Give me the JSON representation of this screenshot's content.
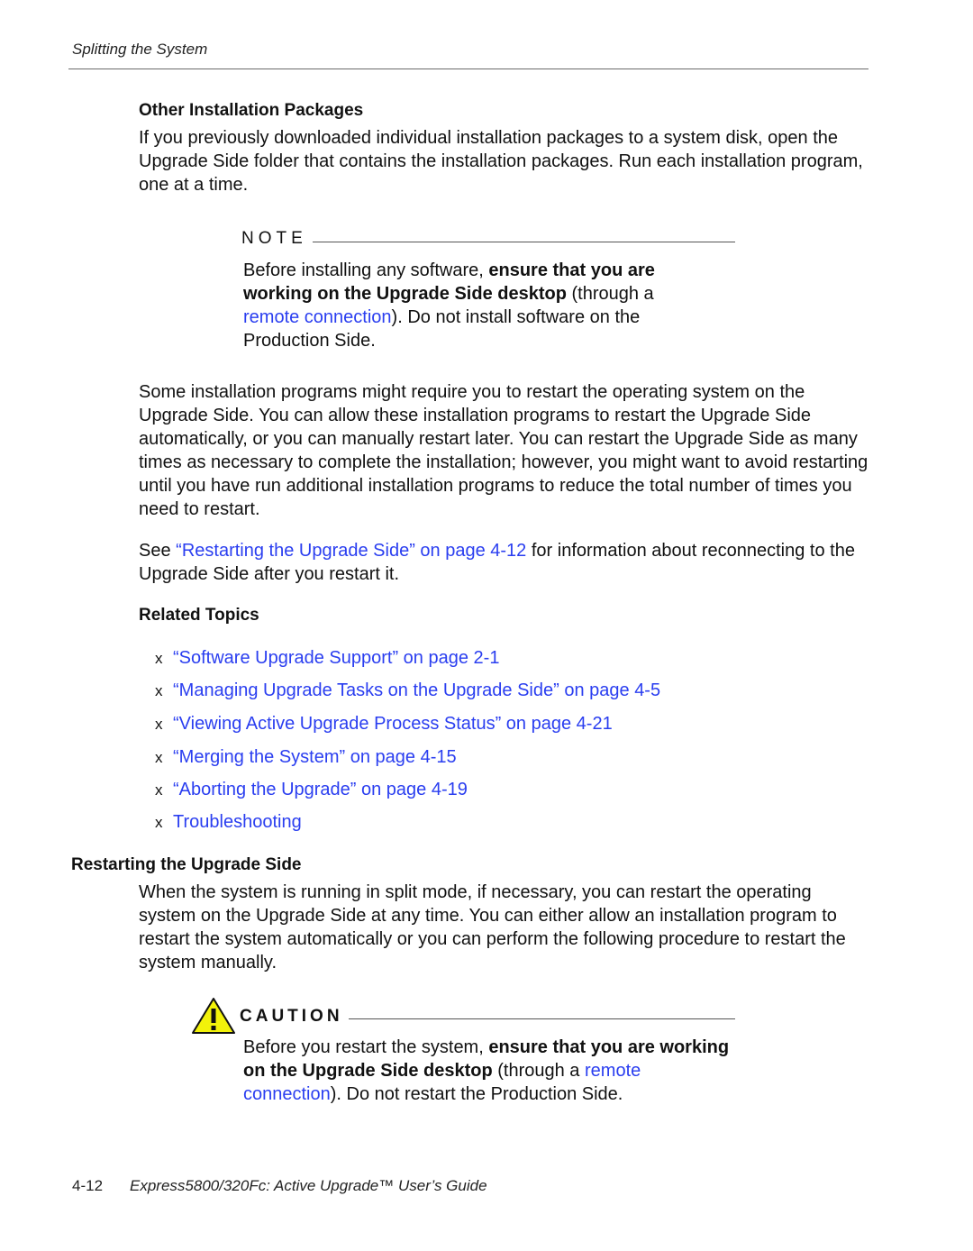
{
  "header": {
    "running_head": "Splitting the System"
  },
  "section_other_packages": {
    "heading": "Other Installation Packages",
    "body": "If you previously downloaded individual installation packages to a system disk, open the Upgrade Side folder that contains the installation packages. Run each installation program, one at a time."
  },
  "note": {
    "label": "NOTE",
    "text_before": "Before installing any software, ",
    "bold": "ensure that you are working on the Upgrade Side desktop",
    "text_mid": " (through a ",
    "link": "remote connection",
    "text_after": "). Do not install software on the Production Side."
  },
  "restart_paragraph": "Some installation programs might require you to restart the operating system on the Upgrade Side. You can allow these installation programs to restart the Upgrade Side automatically, or you can manually restart later. You can restart the Upgrade Side as many times as necessary to complete the installation; however, you might want to avoid restarting until you have run additional installation programs to reduce the total number of times you need to restart.",
  "see_paragraph": {
    "prefix": "See ",
    "link": "“Restarting the Upgrade Side” on page 4-12",
    "suffix": " for information about reconnecting to the Upgrade Side after you restart it."
  },
  "related_topics": {
    "heading": "Related Topics",
    "bullet": "x",
    "items": [
      "“Software Upgrade Support” on page 2-1",
      "“Managing Upgrade Tasks on the Upgrade Side” on page 4-5",
      "“Viewing Active Upgrade Process Status” on page 4-21",
      "“Merging the System” on page 4-15",
      "“Aborting the Upgrade” on page 4-19",
      "Troubleshooting"
    ]
  },
  "section_restarting": {
    "heading": "Restarting the Upgrade Side",
    "body": "When the system is running in split mode, if necessary, you can restart the operating system on the Upgrade Side at any time. You can either allow an installation program to restart the system automatically or you can perform the following procedure to restart the system manually."
  },
  "caution": {
    "label": "CAUTION",
    "icon": "warning-triangle-icon",
    "icon_color": "#f2f20a",
    "text_before": "Before you restart the system, ",
    "bold": "ensure that you are working on the Upgrade Side desktop",
    "text_mid": " (through a ",
    "link": "remote connection",
    "text_after": "). Do not restart the Production Side."
  },
  "footer": {
    "page_number": "4-12",
    "title": "Express5800/320Fc: Active Upgrade™ User’s Guide"
  },
  "colors": {
    "link": "#2a3ef0",
    "text": "#111111"
  }
}
